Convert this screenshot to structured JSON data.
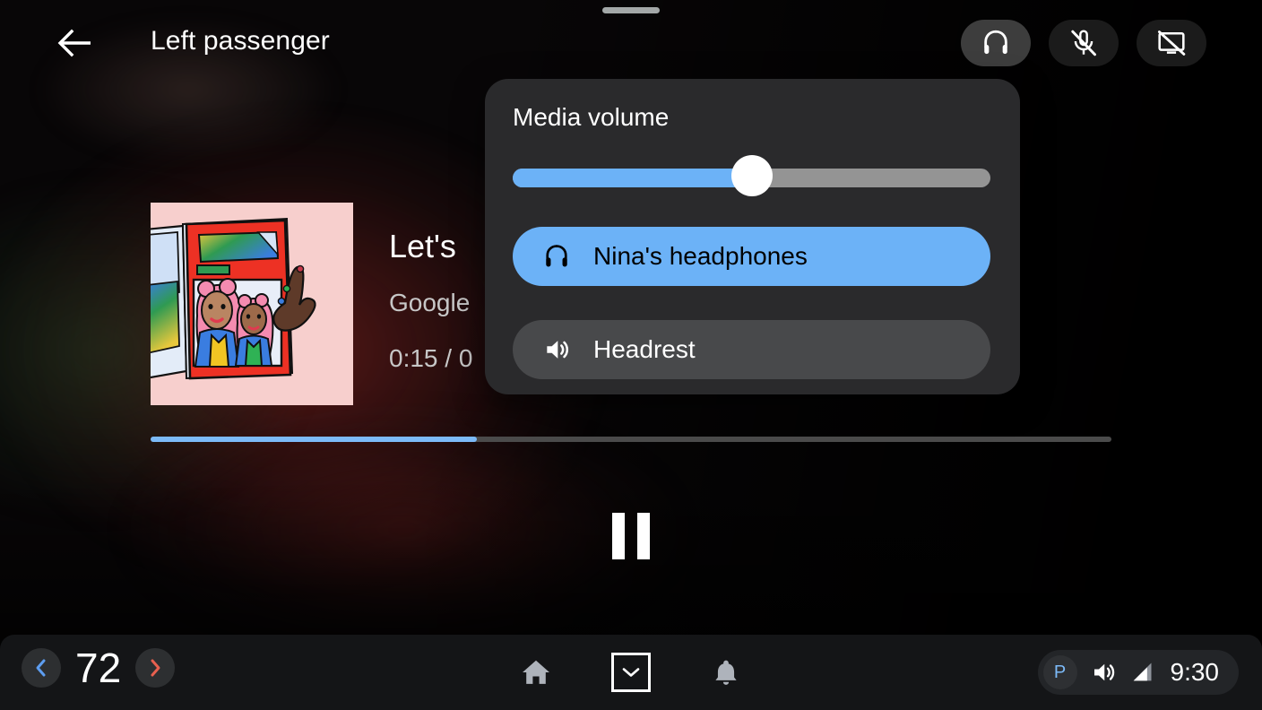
{
  "header": {
    "title": "Left passenger",
    "back_icon": "arrow-left-icon",
    "actions": [
      {
        "name": "headphones",
        "icon": "headphones-icon",
        "active": true
      },
      {
        "name": "microphone-off",
        "icon": "mic-off-icon",
        "active": false
      },
      {
        "name": "screen-off",
        "icon": "screen-off-icon",
        "active": false
      }
    ]
  },
  "media": {
    "track_title": "Let's",
    "artist": "Google",
    "time": "0:15 / 0",
    "progress_percent": 34,
    "transport_state": "playing",
    "pause_icon": "pause-icon",
    "album_art_alt": "two-women-pink-hair-magazine-illustration"
  },
  "volume_popup": {
    "title": "Media volume",
    "slider": {
      "value_percent": 50,
      "fill_color": "#6cb2f7",
      "track_color": "#949494",
      "thumb_color": "#ffffff"
    },
    "devices": [
      {
        "label": "Nina's headphones",
        "icon": "headphones-icon",
        "selected": true,
        "color": "#6cb2f7"
      },
      {
        "label": "Headrest",
        "icon": "speaker-volume-icon",
        "selected": false,
        "color": "#48494b"
      }
    ]
  },
  "navbar": {
    "temperature": {
      "value": "72",
      "decrease_icon": "chevron-left-icon",
      "decrease_color": "#5d9df0",
      "increase_icon": "chevron-right-icon",
      "increase_color": "#e8604f"
    },
    "center_items": [
      {
        "name": "home",
        "icon": "home-icon",
        "focused": false
      },
      {
        "name": "expand",
        "icon": "chevron-down-icon",
        "focused": true
      },
      {
        "name": "notifications",
        "icon": "bell-icon",
        "focused": false
      }
    ],
    "status": {
      "gear_label": "P",
      "gear_color": "#7cbaf8",
      "volume_icon": "speaker-volume-icon",
      "signal_icon": "signal-bars-icon",
      "time": "9:30"
    }
  }
}
